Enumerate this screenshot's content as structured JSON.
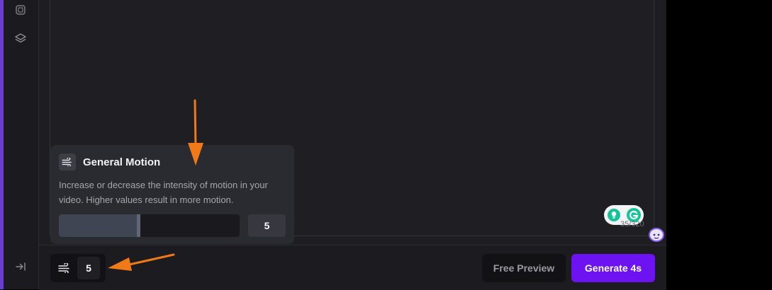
{
  "sidebar": {
    "icons": [
      "chip-icon",
      "layers-icon",
      "expand-panel-icon"
    ]
  },
  "popover": {
    "title": "General Motion",
    "description": "Increase or decrease the intensity of motion in your video. Higher values result in more motion.",
    "value": "5",
    "fill_fraction": 0.45
  },
  "prompt": {
    "char_counter": "35/320"
  },
  "bottom_bar": {
    "motion_value": "5",
    "preview_label": "Free Preview",
    "generate_label": "Generate 4s"
  },
  "colors": {
    "accent": "#6d12f0",
    "annotation_arrow": "#f07a17",
    "sidebar_edge": "#6b3bd6"
  }
}
